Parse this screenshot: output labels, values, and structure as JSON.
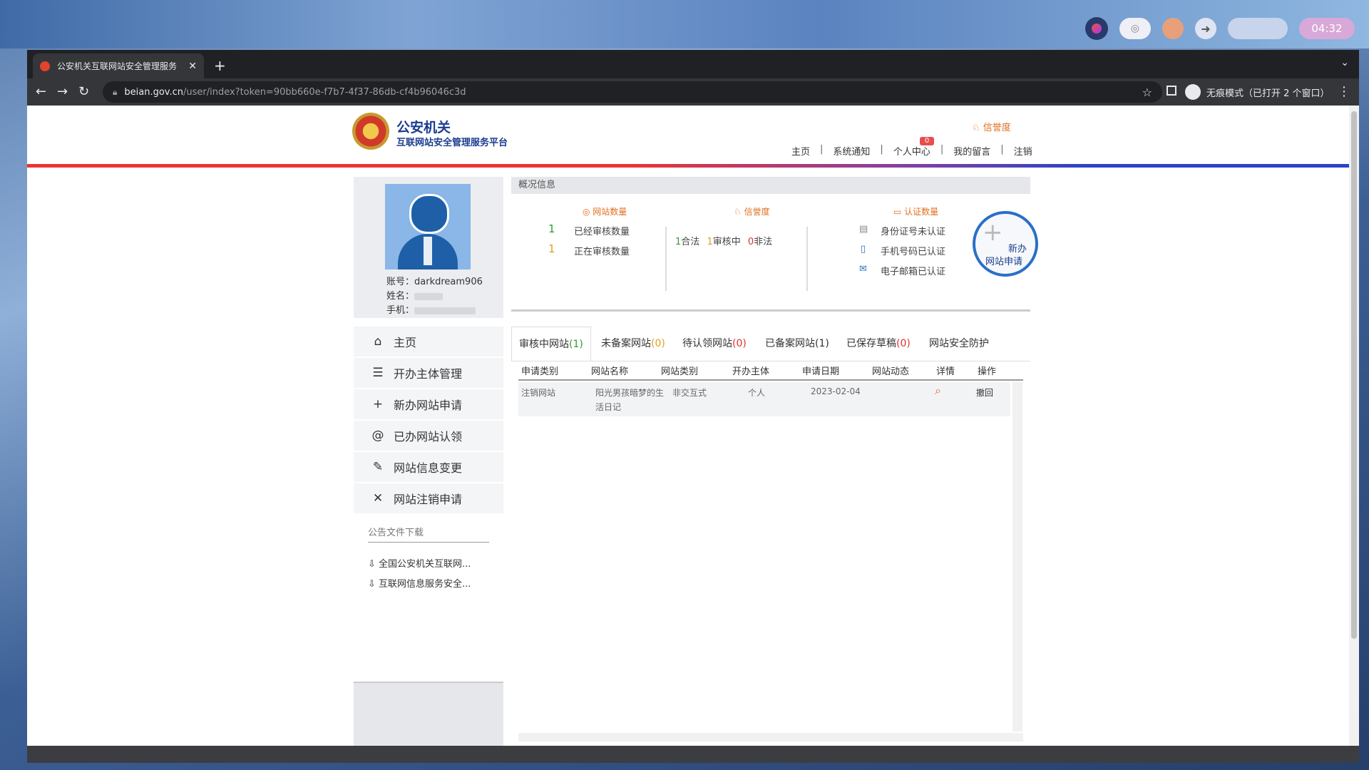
{
  "tray": {
    "clock": "04:32"
  },
  "browser": {
    "tab_title": "公安机关互联网站安全管理服务",
    "url_host": "beian.gov.cn",
    "url_path": "/user/index?token=90bb660e-f7b7-4f37-86db-cf4b96046c3d",
    "incognito_label": "无痕模式（已打开 2 个窗口）"
  },
  "header": {
    "brand_title": "公安机关",
    "brand_sub": "互联网站安全管理服务平台",
    "credit": "信誉度",
    "badge": "0",
    "nav": [
      "主页",
      "系统通知",
      "个人中心",
      "我的留言",
      "注销"
    ]
  },
  "profile": {
    "account_label": "账号：",
    "account": "darkdream906",
    "name_label": "姓名：",
    "phone_label": "手机："
  },
  "menu": [
    {
      "icon": "home-icon",
      "label": "主页"
    },
    {
      "icon": "list-icon",
      "label": "开办主体管理"
    },
    {
      "icon": "plus-icon",
      "label": "新办网站申请"
    },
    {
      "icon": "at-icon",
      "label": "已办网站认领"
    },
    {
      "icon": "edit-icon",
      "label": "网站信息变更"
    },
    {
      "icon": "close-icon",
      "label": "网站注销申请"
    }
  ],
  "notices": {
    "title": "公告文件下载",
    "items": [
      "全国公安机关互联网...",
      "互联网信息服务安全..."
    ]
  },
  "overview": {
    "title": "概况信息",
    "site_count": {
      "heading": "网站数量",
      "rows": [
        {
          "num": "1",
          "label": "已经审核数量"
        },
        {
          "num": "1",
          "label": "正在审核数量"
        }
      ]
    },
    "credit": {
      "heading": "信誉度",
      "legal_num": "1",
      "legal": "合法",
      "review_num": "1",
      "review": "审核中",
      "illegal_num": "0",
      "illegal": "非法"
    },
    "certs": {
      "heading": "认证数量",
      "items": [
        "身份证号未认证",
        "手机号码已认证",
        "电子邮箱已认证"
      ]
    },
    "new_btn_line1": "新办",
    "new_btn_line2": "网站申请"
  },
  "tabs": [
    {
      "label": "审核中网站",
      "count": "(1)"
    },
    {
      "label": "未备案网站",
      "count": "(0)"
    },
    {
      "label": "待认领网站",
      "count": "(0)"
    },
    {
      "label": "已备案网站",
      "count": "(1)"
    },
    {
      "label": "已保存草稿",
      "count": "(0)"
    },
    {
      "label": "网站安全防护",
      "count": ""
    }
  ],
  "table": {
    "headers": [
      "申请类别",
      "网站名称",
      "网站类别",
      "开办主体",
      "申请日期",
      "网站动态",
      "详情",
      "操作"
    ],
    "rows": [
      {
        "type": "注销网站",
        "name_l1": "阳光男孩暗梦的生",
        "name_l2": "活日记",
        "category": "非交互式",
        "owner": "个人",
        "date": "2023-02-04",
        "status": "",
        "action": "撤回"
      }
    ]
  }
}
